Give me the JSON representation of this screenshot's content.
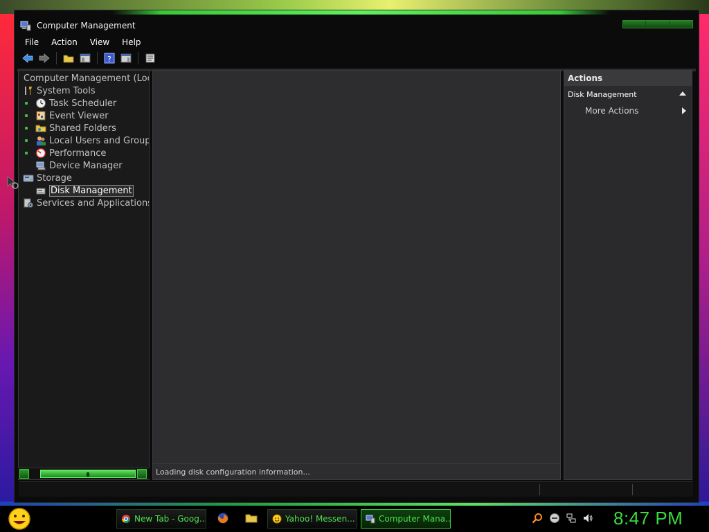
{
  "window": {
    "title": "Computer Management"
  },
  "menu": [
    "File",
    "Action",
    "View",
    "Help"
  ],
  "tree": {
    "root": "Computer Management (Local)",
    "system_tools": "System Tools",
    "task_scheduler": "Task Scheduler",
    "event_viewer": "Event Viewer",
    "shared_folders": "Shared Folders",
    "local_users": "Local Users and Groups",
    "performance": "Performance",
    "device_manager": "Device Manager",
    "storage": "Storage",
    "disk_management": "Disk Management",
    "services": "Services and Applications"
  },
  "center": {
    "status": "Loading disk configuration information..."
  },
  "actions": {
    "header": "Actions",
    "section": "Disk Management",
    "more": "More Actions"
  },
  "taskbar": {
    "tasks": [
      {
        "label": "New Tab - Goog..."
      },
      {
        "label": "Yahoo! Messen..."
      },
      {
        "label": "Computer Mana..."
      }
    ],
    "clock": "8:47 PM"
  },
  "colors": {
    "accent_green": "#3bdc3b",
    "pane_bg": "#2d2d30",
    "window_bg": "#0b0b0b"
  }
}
